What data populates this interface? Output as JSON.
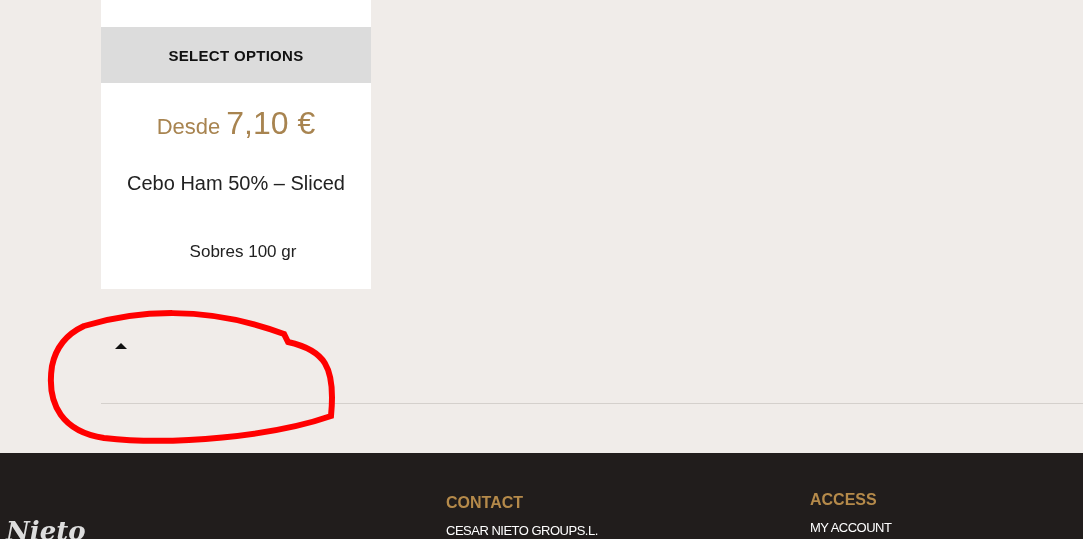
{
  "product": {
    "button": "SELECT OPTIONS",
    "price_prefix": "Desde",
    "price": "7,10 €",
    "title": "Cebo Ham 50% – Sliced",
    "variant": "Sobres 100 gr"
  },
  "toggle": {
    "expanded": true
  },
  "annotation": {
    "kind": "ellipse"
  },
  "footer": {
    "logo": "Nieto",
    "columns": [
      {
        "heading": "CONTACT",
        "items": [
          "CESAR NIETO GROUPS.L."
        ]
      },
      {
        "heading": "ACCESS",
        "items": [
          "MY ACCOUNT"
        ]
      }
    ]
  }
}
